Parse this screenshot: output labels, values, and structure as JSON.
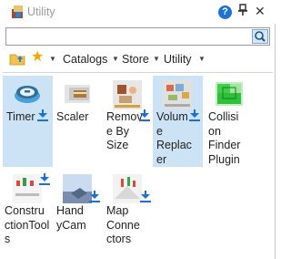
{
  "window": {
    "title": "Utility",
    "help_label": "?",
    "pin_label": "📌",
    "close_label": "✕"
  },
  "search": {
    "value": "",
    "placeholder": ""
  },
  "toolbar": {
    "catalogs_label": "Catalogs",
    "store_label": "Store",
    "utility_label": "Utility"
  },
  "plugins": [
    {
      "name": "Timer",
      "icon": "timer-icon",
      "selected": true,
      "downloadable": true
    },
    {
      "name": "Scaler",
      "icon": "scaler-icon",
      "selected": false,
      "downloadable": false
    },
    {
      "name": "Remove By Size",
      "icon": "remove-by-size-icon",
      "selected": false,
      "downloadable": true
    },
    {
      "name": "Volume Replacer",
      "icon": "volume-replacer-icon",
      "selected": true,
      "downloadable": true
    },
    {
      "name": "Collision Finder Plugin",
      "icon": "collision-finder-icon",
      "selected": false,
      "downloadable": false
    },
    {
      "name": "ConstructionTools",
      "icon": "construction-tools-icon",
      "selected": false,
      "downloadable": true
    },
    {
      "name": "HandyCam",
      "icon": "handycam-icon",
      "selected": false,
      "downloadable": true
    },
    {
      "name": "Map Connectors",
      "icon": "map-connectors-icon",
      "selected": false,
      "downloadable": true
    }
  ],
  "colors": {
    "accent": "#1f6fd0",
    "selection": "#cce3f5",
    "star": "#f5a700"
  }
}
